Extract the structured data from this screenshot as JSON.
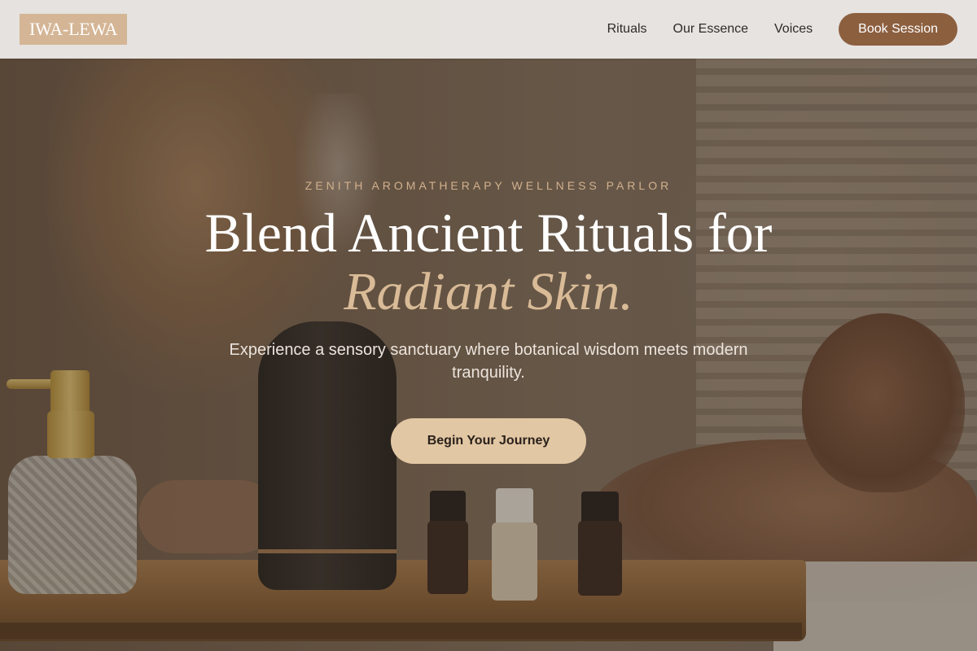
{
  "header": {
    "logo_text": "IWA-LEWA",
    "nav": [
      {
        "label": "Rituals"
      },
      {
        "label": "Our Essence"
      },
      {
        "label": "Voices"
      }
    ],
    "book_button_label": "Book Session"
  },
  "hero": {
    "eyebrow": "ZENITH AROMATHERAPY WELLNESS PARLOR",
    "headline_line1": "Blend Ancient Rituals for",
    "headline_accent": "Radiant Skin.",
    "subtext": "Experience a sensory sanctuary where botanical wisdom meets modern tranquility.",
    "cta_label": "Begin Your Journey"
  },
  "colors": {
    "accent_brown": "#8c5f3f",
    "logo_tan": "#d4b595",
    "cta_beige": "#e2c7a4",
    "accent_text": "#d9bb97"
  }
}
